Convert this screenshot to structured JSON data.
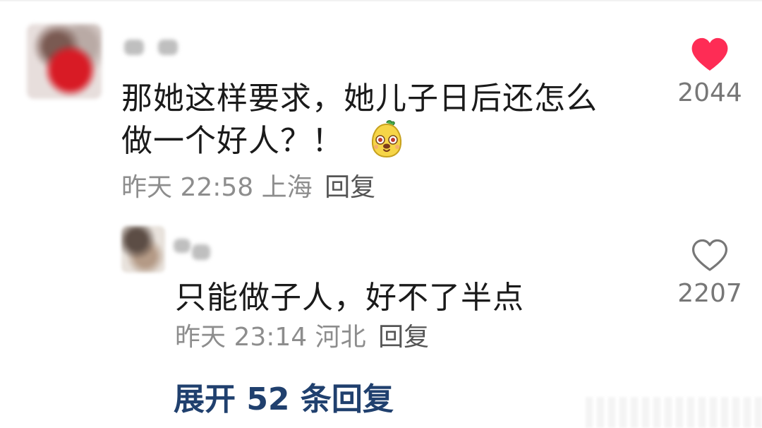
{
  "main_comment": {
    "text_lines": [
      "那她这样要求，她儿子日后还怎么",
      "做一个好人？！"
    ],
    "emoji": "smiling-bun-sticker",
    "time": "昨天 22:58",
    "location": "上海",
    "reply_label": "回复",
    "like_count": "2044",
    "liked": true,
    "heart_color": "#fe2c55"
  },
  "reply_comment": {
    "text": "只能做子人，好不了半点",
    "time": "昨天 23:14",
    "location": "河北",
    "reply_label": "回复",
    "like_count": "2207",
    "liked": false,
    "heart_color": "#777777"
  },
  "expand_replies": {
    "label": "展开 52 条回复",
    "color": "#20406e"
  }
}
